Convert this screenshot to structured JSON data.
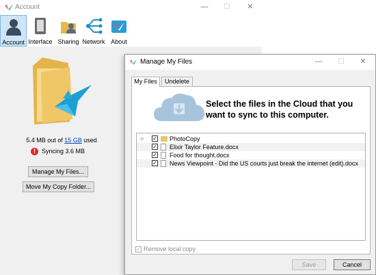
{
  "account_window": {
    "title": "Account",
    "window_controls": {
      "minimize": "—",
      "maximize": "☐",
      "close": "✕"
    },
    "toolbar": [
      {
        "label": "Account",
        "icon": "account-icon",
        "active": true
      },
      {
        "label": "Interface",
        "icon": "interface-icon",
        "active": false
      },
      {
        "label": "Sharing",
        "icon": "sharing-icon",
        "active": false
      },
      {
        "label": "Network",
        "icon": "network-icon",
        "active": false
      },
      {
        "label": "About",
        "icon": "about-icon",
        "active": false
      }
    ],
    "usage": {
      "prefix": "5.4 MB out of ",
      "quota": "15 GB",
      "suffix": " used"
    },
    "sync_status": {
      "icon": "error-icon",
      "glyph": "!",
      "text": "Syncing 3.6 MB"
    },
    "buttons": {
      "manage_files": "Manage My Files...",
      "move_folder": "Move My Copy Folder..."
    }
  },
  "dialog": {
    "title": "Manage My Files",
    "window_controls": {
      "minimize": "—",
      "maximize": "☐",
      "close": "✕"
    },
    "tabs": [
      {
        "label": "My Files",
        "selected": true
      },
      {
        "label": "Undelete",
        "selected": false
      }
    ],
    "headline": "Select the files in the Cloud that you want to sync to this computer.",
    "tree": {
      "expander": ">",
      "items": [
        {
          "name": "PhotoCopy",
          "type": "folder",
          "checked": true
        },
        {
          "name": "Elixir Taylor Feature.docx",
          "type": "file",
          "checked": true
        },
        {
          "name": "Food for thought.docx",
          "type": "file",
          "checked": true
        },
        {
          "name": "News Viewpoint - Did the US courts just break the internet (edit).docx",
          "type": "file",
          "checked": true
        }
      ]
    },
    "remove_local_copy": {
      "label": "Remove local copy",
      "checked": true,
      "enabled": false
    },
    "buttons": {
      "save": "Save",
      "cancel": "Cancel"
    },
    "check_glyph": "✓"
  },
  "colors": {
    "active_tab_bg": "#cde6f7",
    "link": "#0645ad",
    "error": "#e02a2a",
    "cloud": "#a8c4dc"
  }
}
